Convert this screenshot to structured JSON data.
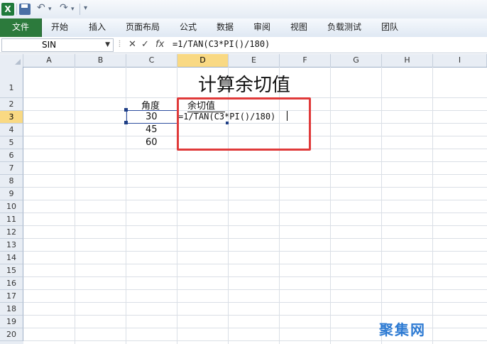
{
  "quick_access": {
    "app_icon": "excel-logo-icon",
    "logo_letter": "X",
    "save_icon": "save-icon",
    "undo_icon": "undo-icon",
    "redo_icon": "redo-icon",
    "customize_icon": "customize-qat-icon"
  },
  "ribbon": {
    "tabs": [
      "文件",
      "开始",
      "插入",
      "页面布局",
      "公式",
      "数据",
      "审阅",
      "视图",
      "负载测试",
      "团队"
    ],
    "active_tab_color": "#2c7a3c"
  },
  "formula_bar": {
    "name_box": "SIN",
    "cancel_symbol": "✕",
    "enter_symbol": "✓",
    "fx_symbol": "fx",
    "formula": "=1/TAN(C3*PI()/180)"
  },
  "columns": [
    "A",
    "B",
    "C",
    "D",
    "E",
    "F",
    "G",
    "H",
    "I"
  ],
  "active_column": "D",
  "rows": [
    "1",
    "2",
    "3",
    "4",
    "5",
    "6",
    "7",
    "8",
    "9",
    "10",
    "11",
    "12",
    "13",
    "14",
    "15",
    "16",
    "17",
    "18",
    "19",
    "20"
  ],
  "active_row": "3",
  "cells": {
    "title": "计算余切值",
    "header_angle": "角度",
    "header_cot": "余切值",
    "c3": "30",
    "c4": "45",
    "c5": "60",
    "d3_formula": "=1/TAN(C3*PI()/180)"
  },
  "highlight_color": "#e03a3a",
  "watermark": "聚集网"
}
